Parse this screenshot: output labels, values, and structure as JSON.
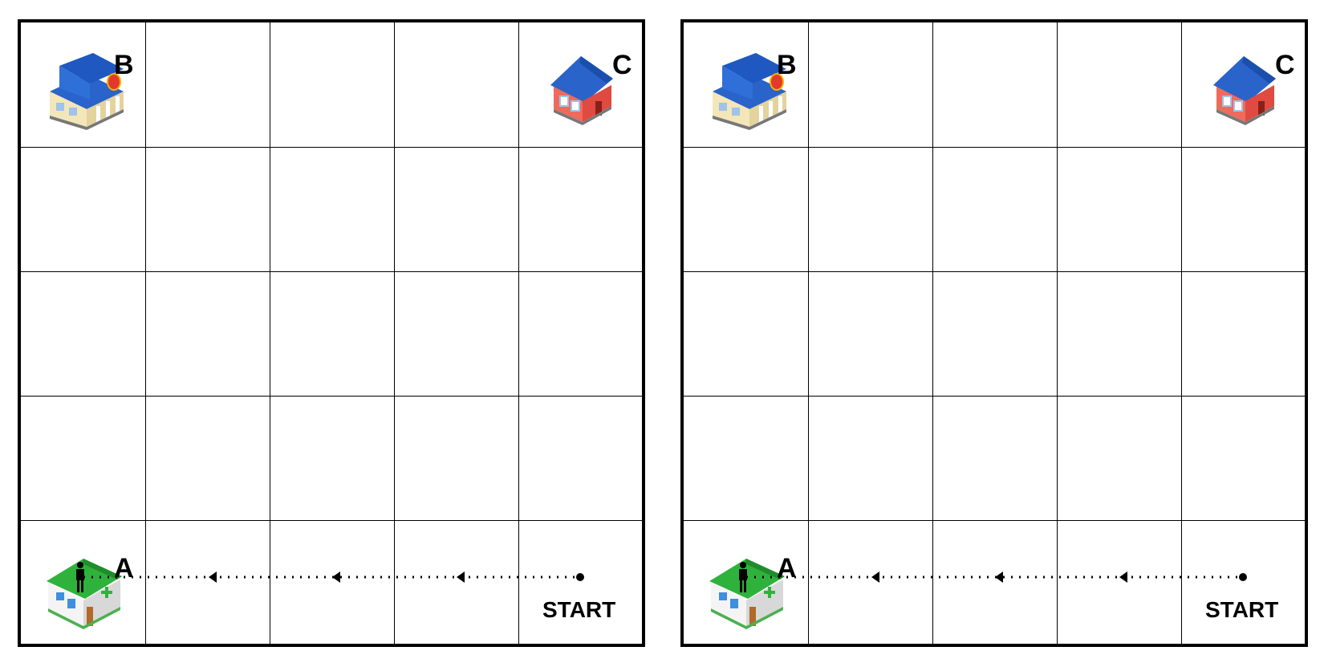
{
  "panels": [
    {
      "id": "left",
      "markers": {
        "A": "A",
        "B": "B",
        "C": "C"
      },
      "start_label": "START"
    },
    {
      "id": "right",
      "markers": {
        "A": "A",
        "B": "B",
        "C": "C"
      },
      "start_label": "START"
    }
  ],
  "grid": {
    "rows": 5,
    "cols": 5
  },
  "colors": {
    "grid_line": "#000000",
    "bank_roof": "#1f5fc4",
    "house_wall": "#e0534a",
    "hospital_roof": "#2fa63a"
  },
  "icons": {
    "B": "bank-building-icon",
    "C": "house-icon",
    "A": "hospital-icon",
    "person": "person-icon"
  }
}
